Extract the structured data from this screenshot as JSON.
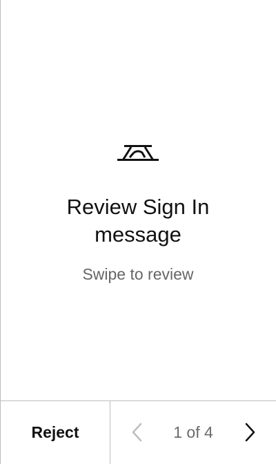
{
  "message": {
    "title": "Review Sign In message",
    "subtitle": "Swipe to review",
    "logo_icon": "arch-logo-icon"
  },
  "footer": {
    "reject_label": "Reject",
    "page_indicator": "1 of 4",
    "prev_icon": "chevron-left-icon",
    "next_icon": "chevron-right-icon"
  },
  "colors": {
    "text_primary": "#111111",
    "text_secondary": "#666666",
    "disabled": "#bdbdbd",
    "divider": "#bdbdbd"
  }
}
